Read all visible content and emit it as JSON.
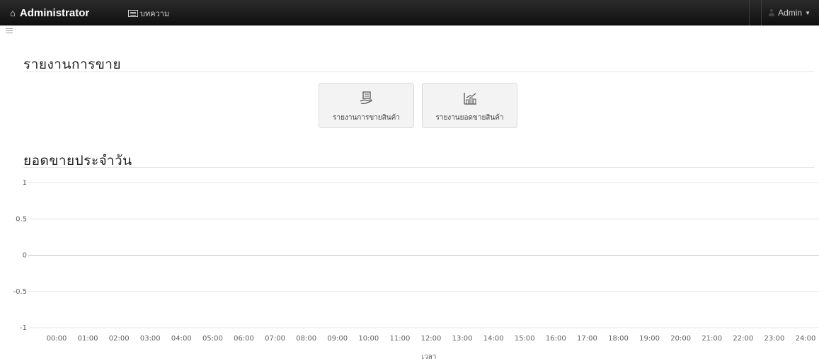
{
  "header": {
    "brand": "Administrator",
    "nav_link": "บทความ",
    "user": "Admin"
  },
  "sections": {
    "sales_report_title": "รายงานการขาย",
    "daily_sales_title": "ยอดขายประจำวัน"
  },
  "buttons": {
    "product_sales_report": "รายงานการขายสินค้า",
    "product_sales_total_report": "รายงานยอดขายสินค้า"
  },
  "chart_data": {
    "type": "line",
    "title": "",
    "xlabel": "เวลา",
    "ylabel": "",
    "categories": [
      "00:00",
      "01:00",
      "02:00",
      "03:00",
      "04:00",
      "05:00",
      "06:00",
      "07:00",
      "08:00",
      "09:00",
      "10:00",
      "11:00",
      "12:00",
      "13:00",
      "14:00",
      "15:00",
      "16:00",
      "17:00",
      "18:00",
      "19:00",
      "20:00",
      "21:00",
      "22:00",
      "23:00",
      "24:00"
    ],
    "y_ticks": [
      "1",
      "0.5",
      "0",
      "-0.5",
      "-1"
    ],
    "ylim": [
      -1,
      1
    ],
    "series": [],
    "grid": true,
    "colors": {
      "grid": "#e6e6e6",
      "zero_line": "#c0c0c0"
    }
  }
}
